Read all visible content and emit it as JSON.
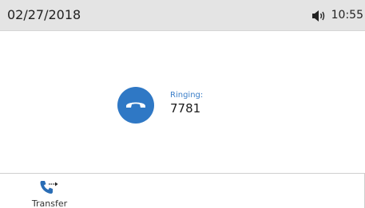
{
  "status_bar": {
    "date": "02/27/2018",
    "time": "10:55",
    "speaker_icon": "speaker-icon"
  },
  "call": {
    "state_label": "Ringing:",
    "number": "7781",
    "icon": "hangup-icon",
    "accent_color": "#2f78c5"
  },
  "softkeys": [
    {
      "label": "Transfer",
      "icon": "transfer-icon"
    }
  ]
}
